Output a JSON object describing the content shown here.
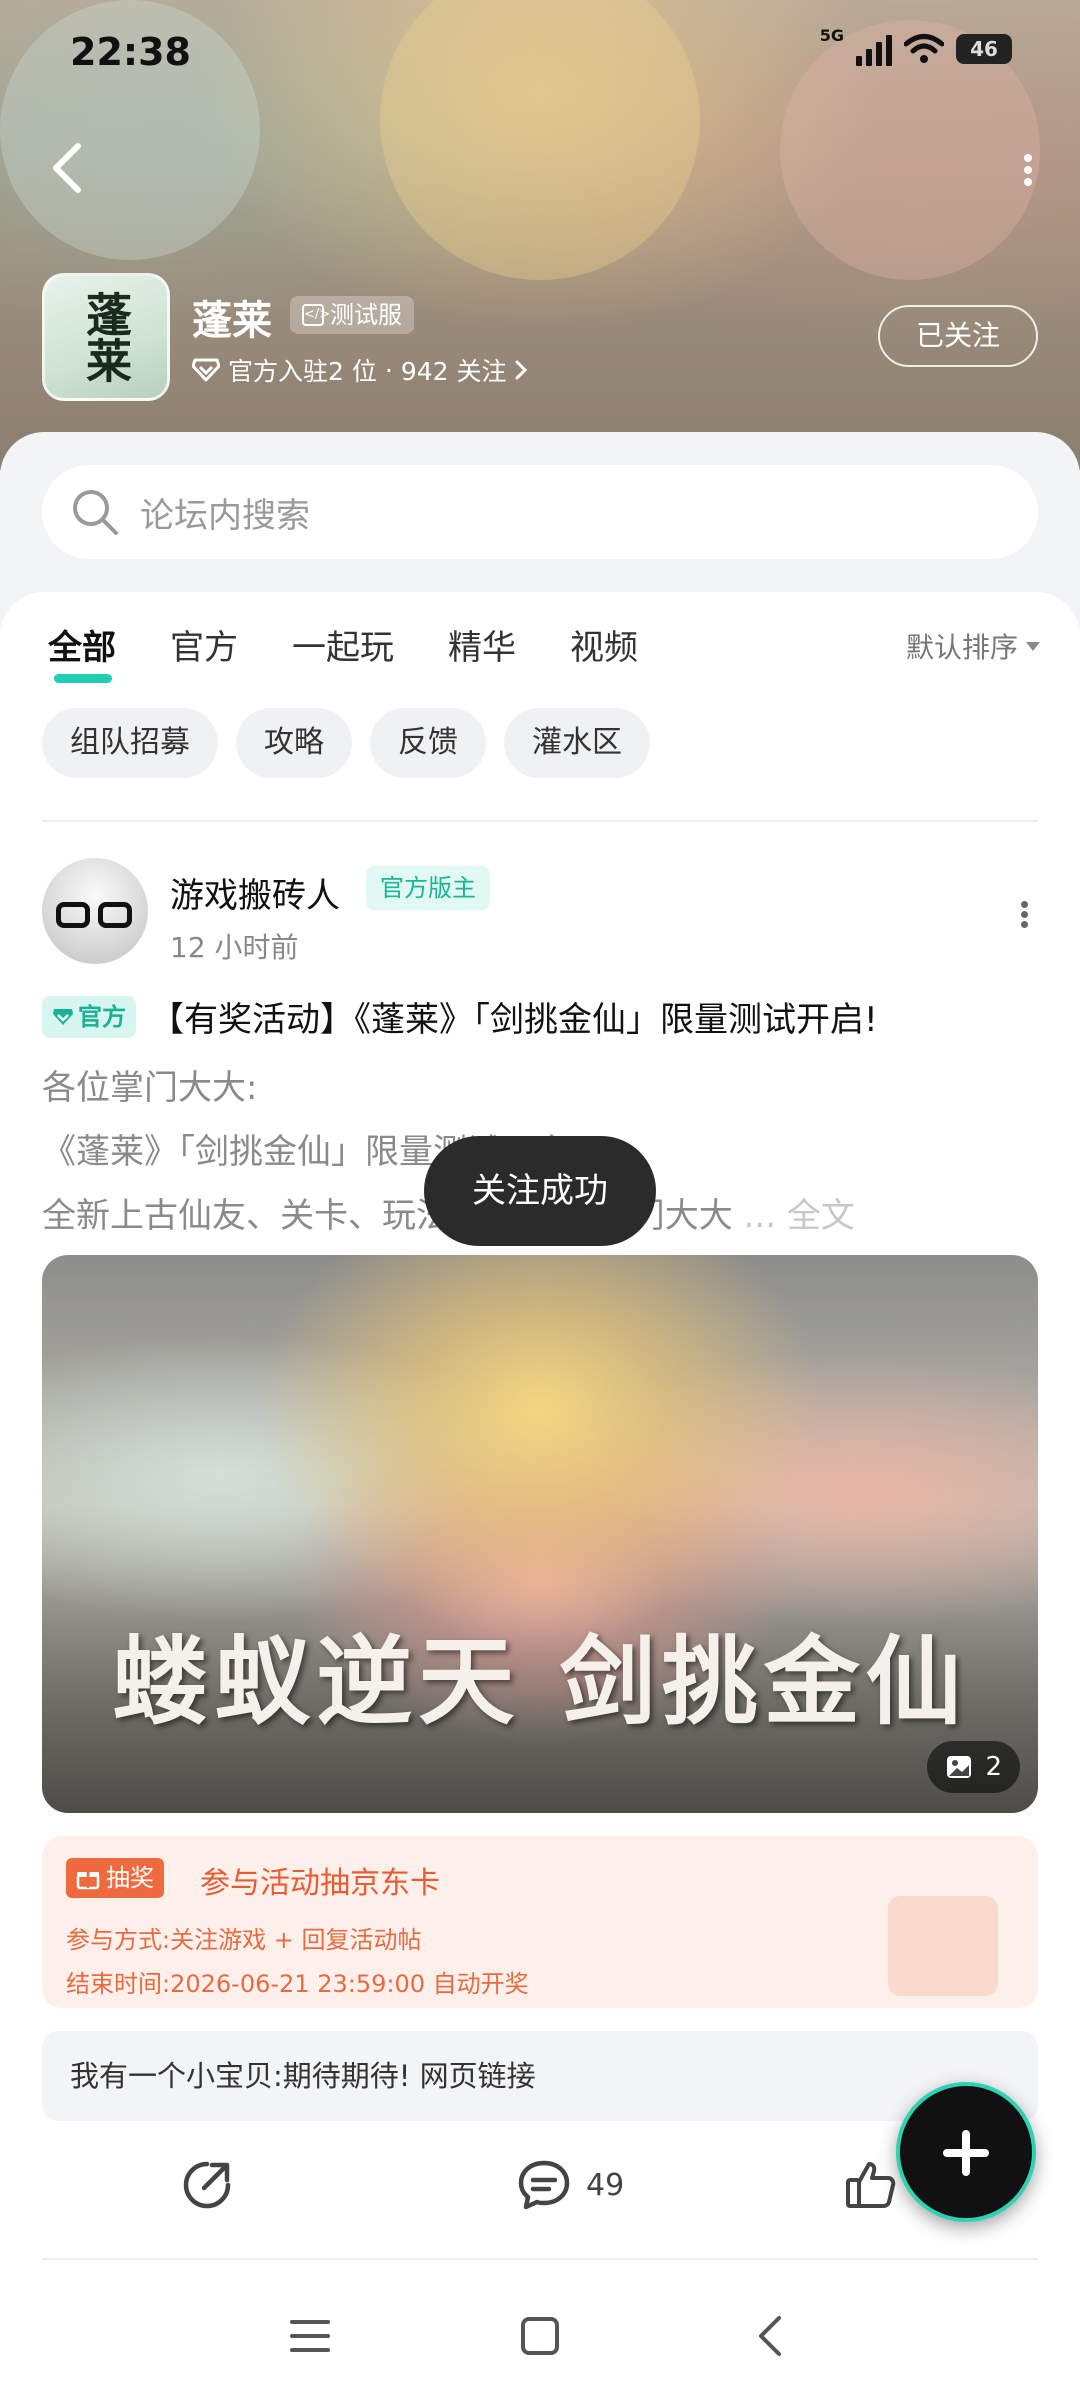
{
  "status_bar": {
    "time": "22:38",
    "network": "5G",
    "battery": "46"
  },
  "header": {
    "back_icon": "chevron-left-icon",
    "more_icon": "more-vertical-icon",
    "game_icon_text": "蓬莱",
    "game_name": "蓬莱",
    "test_tag": "测试服",
    "official_count": "官方入驻2 位",
    "followers": "942 关注",
    "follow_label": "已关注"
  },
  "search": {
    "placeholder": "论坛内搜索",
    "icon": "search-icon"
  },
  "tabs": [
    {
      "label": "全部",
      "active": true
    },
    {
      "label": "官方",
      "active": false
    },
    {
      "label": "一起玩",
      "active": false
    },
    {
      "label": "精华",
      "active": false
    },
    {
      "label": "视频",
      "active": false
    }
  ],
  "sort_label": "默认排序",
  "chips": [
    "组队招募",
    "攻略",
    "反馈",
    "灌水区"
  ],
  "post": {
    "author": "游戏搬砖人",
    "author_badge": "官方版主",
    "time": "12 小时前",
    "official_tag": "官方",
    "title": "【有奖活动】《蓬莱》「剑挑金仙」限量测试开启!",
    "body": [
      "各位掌门大大:",
      "《蓬莱》「剑挑金仙」限量测试开启!",
      "全新上古仙友、关卡、玩法,等待各位掌门大大"
    ],
    "ellipsis": "...",
    "full_text_label": "全文",
    "image_caption": "蝼蚁逆天 剑挑金仙",
    "image_count": "2",
    "lottery": {
      "badge": "抽奖",
      "title": "参与活动抽京东卡",
      "method": "参与方式:关注游戏 + 回复活动帖",
      "end_time": "结束时间:2026-06-21 23:59:00 自动开奖"
    },
    "comment_preview": "我有一个小宝贝:期待期待! 网页链接",
    "comment_count": "49"
  },
  "toast": "关注成功",
  "colors": {
    "accent": "#1fcfb2",
    "lottery": "#e95c32"
  }
}
